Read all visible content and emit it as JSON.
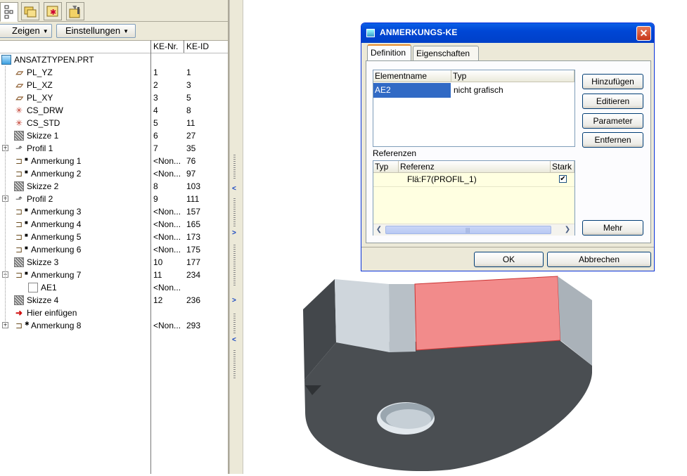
{
  "model_tree": {
    "toolbar": {
      "show_label": "Zeigen",
      "settings_label": "Einstellungen"
    },
    "columns": [
      "KE-Nr.",
      "KE-ID"
    ],
    "rows": [
      {
        "label": "ANSATZTYPEN.PRT",
        "kenr": "",
        "keid": "",
        "icon": "part-icon"
      },
      {
        "label": "PL_YZ",
        "kenr": "1",
        "keid": "1",
        "icon": "datum-plane-icon"
      },
      {
        "label": "PL_XZ",
        "kenr": "2",
        "keid": "3",
        "icon": "datum-plane-icon"
      },
      {
        "label": "PL_XY",
        "kenr": "3",
        "keid": "5",
        "icon": "datum-plane-icon"
      },
      {
        "label": "CS_DRW",
        "kenr": "4",
        "keid": "8",
        "icon": "coordinate-system-icon"
      },
      {
        "label": "CS_STD",
        "kenr": "5",
        "keid": "11",
        "icon": "coordinate-system-icon"
      },
      {
        "label": "Skizze 1",
        "kenr": "6",
        "keid": "27",
        "icon": "sketch-icon"
      },
      {
        "label": "Profil 1",
        "kenr": "7",
        "keid": "35",
        "icon": "profile-icon"
      },
      {
        "label": "Anmerkung 1",
        "kenr": "<Non...",
        "keid": "76",
        "icon": "annotation-icon"
      },
      {
        "label": "Anmerkung 2",
        "kenr": "<Non...",
        "keid": "97",
        "icon": "annotation-icon"
      },
      {
        "label": "Skizze 2",
        "kenr": "8",
        "keid": "103",
        "icon": "sketch-icon"
      },
      {
        "label": "Profil 2",
        "kenr": "9",
        "keid": "111",
        "icon": "profile-icon"
      },
      {
        "label": "Anmerkung 3",
        "kenr": "<Non...",
        "keid": "157",
        "icon": "annotation-icon"
      },
      {
        "label": "Anmerkung 4",
        "kenr": "<Non...",
        "keid": "165",
        "icon": "annotation-icon"
      },
      {
        "label": "Anmerkung 5",
        "kenr": "<Non...",
        "keid": "173",
        "icon": "annotation-icon"
      },
      {
        "label": "Anmerkung 6",
        "kenr": "<Non...",
        "keid": "175",
        "icon": "annotation-icon"
      },
      {
        "label": "Skizze 3",
        "kenr": "10",
        "keid": "177",
        "icon": "sketch-icon"
      },
      {
        "label": "Anmerkung 7",
        "kenr": "11",
        "keid": "234",
        "icon": "annotation-icon"
      },
      {
        "label": "AE1",
        "kenr": "<Non...",
        "keid": "",
        "icon": "annotation-element-icon"
      },
      {
        "label": "Skizze 4",
        "kenr": "12",
        "keid": "236",
        "icon": "sketch-icon"
      },
      {
        "label": "Hier einfügen",
        "kenr": "",
        "keid": "",
        "icon": "insert-here-arrow-icon"
      },
      {
        "label": "Anmerkung 8",
        "kenr": "<Non...",
        "keid": "293",
        "icon": "annotation-icon"
      }
    ]
  },
  "dialog": {
    "title": "ANMERKUNGS-KE",
    "tabs": [
      "Definition",
      "Eigenschaften"
    ],
    "elements_table": {
      "headers": [
        "Elementname",
        "Typ"
      ],
      "rows": [
        {
          "name": "AE2",
          "type": "nicht grafisch"
        }
      ]
    },
    "references_label": "Referenzen",
    "references_table": {
      "headers": [
        "Typ",
        "Referenz",
        "Stark"
      ],
      "rows": [
        {
          "type": "",
          "reference": "Flä:F7(PROFIL_1)",
          "strong": true
        }
      ]
    },
    "buttons": {
      "add": "Hinzufügen",
      "edit": "Editieren",
      "parameters": "Parameter",
      "remove": "Entfernen",
      "more": "Mehr",
      "ok": "OK",
      "cancel": "Abbrechen"
    }
  },
  "colors": {
    "title_bar": "#0054e3",
    "selection": "#316ac5",
    "highlight_surface": "#f28b8b",
    "model_dark": "#4a4e52",
    "model_light": "#cfd6dc"
  }
}
